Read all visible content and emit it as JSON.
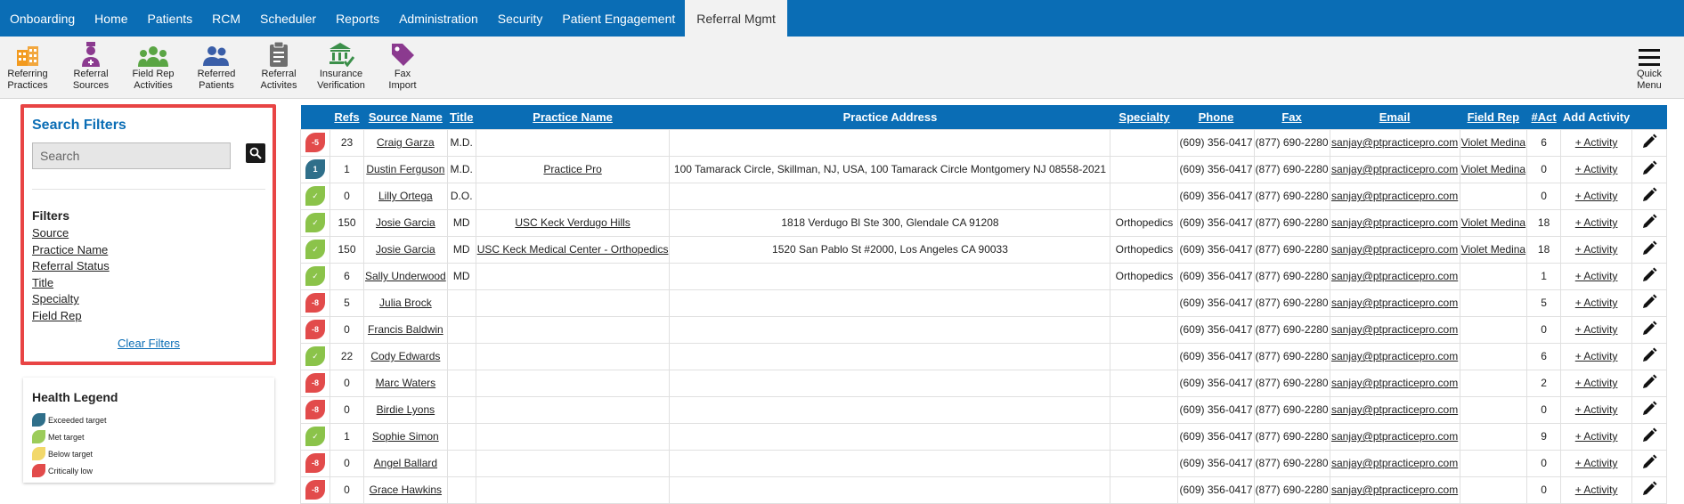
{
  "nav": {
    "items": [
      "Onboarding",
      "Home",
      "Patients",
      "RCM",
      "Scheduler",
      "Reports",
      "Administration",
      "Security",
      "Patient Engagement",
      "Referral Mgmt"
    ],
    "active": "Referral Mgmt"
  },
  "toolbar": {
    "tools": [
      {
        "line1": "Referring",
        "line2": "Practices",
        "icon": "building-icon",
        "color": "#f29a1f"
      },
      {
        "line1": "Referral",
        "line2": "Sources",
        "icon": "doctor-icon",
        "color": "#8b3a8f"
      },
      {
        "line1": "Field Rep",
        "line2": "Activities",
        "icon": "group-icon",
        "color": "#5aa544"
      },
      {
        "line1": "Referred",
        "line2": "Patients",
        "icon": "users-icon",
        "color": "#3a5ea8"
      },
      {
        "line1": "Referral",
        "line2": "Activites",
        "icon": "clipboard-icon",
        "color": "#6e6e6e"
      },
      {
        "line1": "Insurance",
        "line2": "Verification",
        "icon": "bank-check-icon",
        "color": "#3b8f4a"
      },
      {
        "line1": "Fax",
        "line2": "Import",
        "icon": "tag-icon",
        "color": "#8b3a8f"
      }
    ],
    "quick_menu": {
      "line1": "Quick",
      "line2": "Menu"
    }
  },
  "filters": {
    "title": "Search Filters",
    "search_placeholder": "Search",
    "heading": "Filters",
    "links": [
      "Source",
      "Practice Name",
      "Referral Status",
      "Title",
      "Specialty",
      "Field Rep"
    ],
    "clear": "Clear Filters"
  },
  "legend": {
    "title": "Health Legend",
    "items": [
      {
        "label": "Exceeded target",
        "color": "#2f6f8a"
      },
      {
        "label": "Met target",
        "color": "#9ccc5a"
      },
      {
        "label": "Below target",
        "color": "#f2d86a"
      },
      {
        "label": "Critically low",
        "color": "#e24b4b"
      }
    ]
  },
  "colors": {
    "exceeded": "#2f6f8a",
    "met": "#8bc34a",
    "below": "#f2d86a",
    "critical": "#e24b4b",
    "brand": "#0a6db5"
  },
  "table": {
    "headers": [
      "Refs",
      "Source Name",
      "Title",
      "Practice Name",
      "Practice Address",
      "Specialty",
      "Phone",
      "Fax",
      "Email",
      "Field Rep",
      "#Act",
      "Add Activity"
    ],
    "rows": [
      {
        "status": "critical",
        "badge": "-5",
        "refs": "23",
        "source": "Craig Garza",
        "title": "M.D.",
        "practice": "",
        "address": "",
        "specialty": "",
        "phone": "(609) 356-0417",
        "fax": "(877) 690-2280",
        "email": "sanjay@ptpracticepro.com",
        "rep": "Violet Medina",
        "act": "6",
        "add": "+ Activity"
      },
      {
        "status": "exceeded",
        "badge": "1",
        "refs": "1",
        "source": "Dustin Ferguson",
        "title": "M.D.",
        "practice": "Practice Pro",
        "address": "100 Tamarack Circle, Skillman, NJ, USA, 100 Tamarack Circle Montgomery NJ 08558-2021",
        "specialty": "",
        "phone": "(609) 356-0417",
        "fax": "(877) 690-2280",
        "email": "sanjay@ptpracticepro.com",
        "rep": "Violet Medina",
        "act": "0",
        "add": "+ Activity"
      },
      {
        "status": "met",
        "badge": "✓",
        "refs": "0",
        "source": "Lilly Ortega",
        "title": "D.O.",
        "practice": "",
        "address": "",
        "specialty": "",
        "phone": "(609) 356-0417",
        "fax": "(877) 690-2280",
        "email": "sanjay@ptpracticepro.com",
        "rep": "",
        "act": "0",
        "add": "+ Activity"
      },
      {
        "status": "met",
        "badge": "✓",
        "refs": "150",
        "source": "Josie Garcia",
        "title": "MD",
        "practice": "USC Keck Verdugo Hills",
        "address": "1818 Verdugo Bl Ste 300, Glendale CA 91208",
        "specialty": "Orthopedics",
        "phone": "(609) 356-0417",
        "fax": "(877) 690-2280",
        "email": "sanjay@ptpracticepro.com",
        "rep": "Violet Medina",
        "act": "18",
        "add": "+ Activity"
      },
      {
        "status": "met",
        "badge": "✓",
        "refs": "150",
        "source": "Josie Garcia",
        "title": "MD",
        "practice": "USC Keck Medical Center - Orthopedics",
        "address": "1520 San Pablo St #2000, Los Angeles CA 90033",
        "specialty": "Orthopedics",
        "phone": "(609) 356-0417",
        "fax": "(877) 690-2280",
        "email": "sanjay@ptpracticepro.com",
        "rep": "Violet Medina",
        "act": "18",
        "add": "+ Activity"
      },
      {
        "status": "met",
        "badge": "✓",
        "refs": "6",
        "source": "Sally Underwood",
        "title": "MD",
        "practice": "",
        "address": "",
        "specialty": "Orthopedics",
        "phone": "(609) 356-0417",
        "fax": "(877) 690-2280",
        "email": "sanjay@ptpracticepro.com",
        "rep": "",
        "act": "1",
        "add": "+ Activity"
      },
      {
        "status": "critical",
        "badge": "-8",
        "refs": "5",
        "source": "Julia Brock",
        "title": "",
        "practice": "",
        "address": "",
        "specialty": "",
        "phone": "(609) 356-0417",
        "fax": "(877) 690-2280",
        "email": "sanjay@ptpracticepro.com",
        "rep": "",
        "act": "5",
        "add": "+ Activity"
      },
      {
        "status": "critical",
        "badge": "-8",
        "refs": "0",
        "source": "Francis Baldwin",
        "title": "",
        "practice": "",
        "address": "",
        "specialty": "",
        "phone": "(609) 356-0417",
        "fax": "(877) 690-2280",
        "email": "sanjay@ptpracticepro.com",
        "rep": "",
        "act": "0",
        "add": "+ Activity"
      },
      {
        "status": "met",
        "badge": "✓",
        "refs": "22",
        "source": "Cody Edwards",
        "title": "",
        "practice": "",
        "address": "",
        "specialty": "",
        "phone": "(609) 356-0417",
        "fax": "(877) 690-2280",
        "email": "sanjay@ptpracticepro.com",
        "rep": "",
        "act": "6",
        "add": "+ Activity"
      },
      {
        "status": "critical",
        "badge": "-8",
        "refs": "0",
        "source": "Marc Waters",
        "title": "",
        "practice": "",
        "address": "",
        "specialty": "",
        "phone": "(609) 356-0417",
        "fax": "(877) 690-2280",
        "email": "sanjay@ptpracticepro.com",
        "rep": "",
        "act": "2",
        "add": "+ Activity"
      },
      {
        "status": "critical",
        "badge": "-8",
        "refs": "0",
        "source": "Birdie Lyons",
        "title": "",
        "practice": "",
        "address": "",
        "specialty": "",
        "phone": "(609) 356-0417",
        "fax": "(877) 690-2280",
        "email": "sanjay@ptpracticepro.com",
        "rep": "",
        "act": "0",
        "add": "+ Activity"
      },
      {
        "status": "met",
        "badge": "✓",
        "refs": "1",
        "source": "Sophie Simon",
        "title": "",
        "practice": "",
        "address": "",
        "specialty": "",
        "phone": "(609) 356-0417",
        "fax": "(877) 690-2280",
        "email": "sanjay@ptpracticepro.com",
        "rep": "",
        "act": "9",
        "add": "+ Activity"
      },
      {
        "status": "critical",
        "badge": "-8",
        "refs": "0",
        "source": "Angel Ballard",
        "title": "",
        "practice": "",
        "address": "",
        "specialty": "",
        "phone": "(609) 356-0417",
        "fax": "(877) 690-2280",
        "email": "sanjay@ptpracticepro.com",
        "rep": "",
        "act": "0",
        "add": "+ Activity"
      },
      {
        "status": "critical",
        "badge": "-8",
        "refs": "0",
        "source": "Grace Hawkins",
        "title": "",
        "practice": "",
        "address": "",
        "specialty": "",
        "phone": "(609) 356-0417",
        "fax": "(877) 690-2280",
        "email": "sanjay@ptpracticepro.com",
        "rep": "",
        "act": "0",
        "add": "+ Activity"
      }
    ]
  }
}
